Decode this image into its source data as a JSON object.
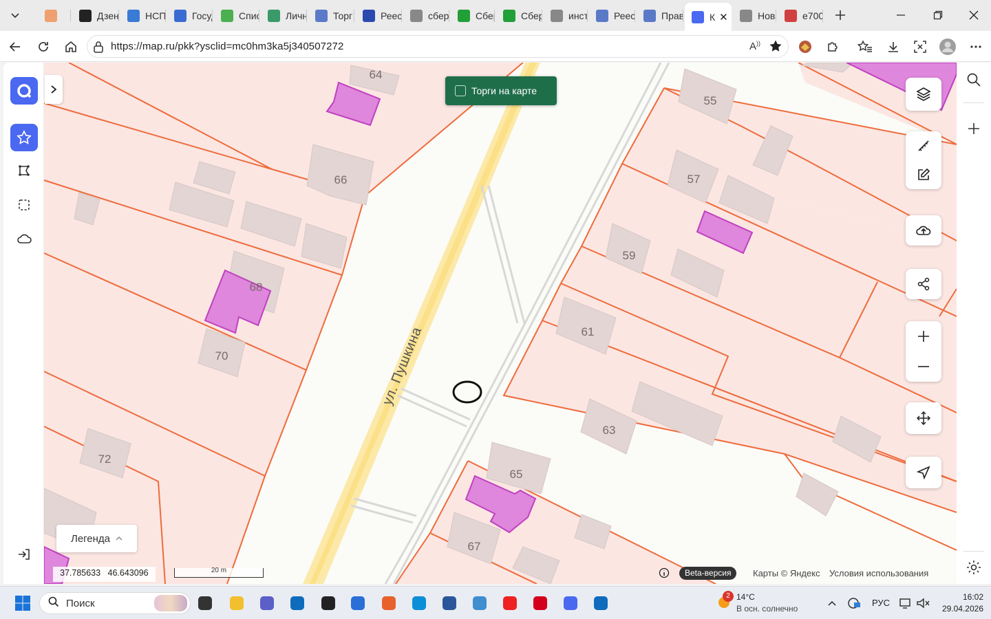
{
  "browser": {
    "tabs": [
      {
        "title": "",
        "color": "#f0a070"
      },
      {
        "title": "Дзен",
        "color": "#222"
      },
      {
        "title": "НСПД",
        "color": "#3a7bd5"
      },
      {
        "title": "Госуд",
        "color": "#3a6bd0"
      },
      {
        "title": "Спис",
        "color": "#4caf50"
      },
      {
        "title": "Личн",
        "color": "#3a9a6a"
      },
      {
        "title": "Торг",
        "color": "#5a7ac8"
      },
      {
        "title": "Реест",
        "color": "#2a4ab0"
      },
      {
        "title": "сбер",
        "color": "#888"
      },
      {
        "title": "Сбер",
        "color": "#21a038"
      },
      {
        "title": "Сбер",
        "color": "#21a038"
      },
      {
        "title": "инст",
        "color": "#888"
      },
      {
        "title": "Реес",
        "color": "#5a7ac8"
      },
      {
        "title": "Прав",
        "color": "#5a7ac8"
      },
      {
        "title": "К",
        "color": "#4a68f0"
      },
      {
        "title": "Нова",
        "color": "#888"
      },
      {
        "title": "е700",
        "color": "#d04040"
      }
    ],
    "url": "https://map.ru/pkk?ysclid=mc0hm3ka5j340507272",
    "reader_label": "A⁰"
  },
  "map": {
    "torgi_label": "Торги на карте",
    "street_label": "ул. Пушкина",
    "legend_label": "Легенда",
    "coords": "37.785633   46.643096",
    "scale_label": "20 m",
    "beta_label": "Beta-версия",
    "copyright": "Карты © Яндекс",
    "terms": "Условия использования",
    "house_numbers": [
      "64",
      "66",
      "68",
      "70",
      "72",
      "55",
      "57",
      "59",
      "61",
      "63",
      "65",
      "67"
    ]
  },
  "taskbar": {
    "search_placeholder": "Поиск",
    "weather_temp": "14°C",
    "weather_desc": "В осн. солнечно",
    "weather_badge": "2",
    "lang": "РУС",
    "time": "16:02",
    "date": "29.04.2026"
  }
}
